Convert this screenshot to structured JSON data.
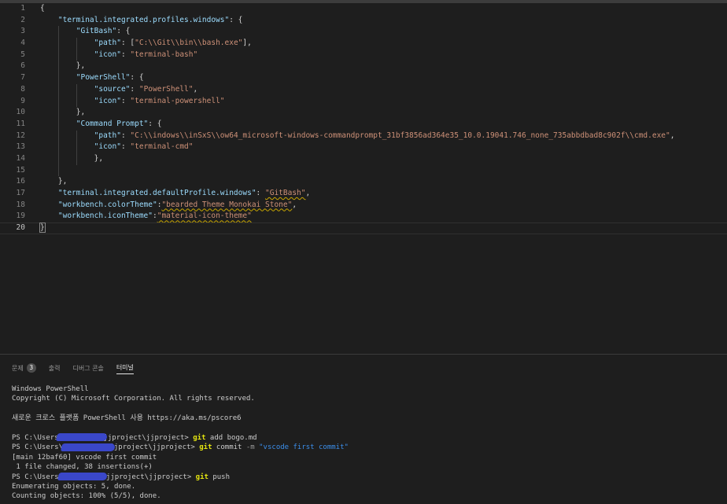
{
  "editor": {
    "lines": [
      {
        "n": "1",
        "indent": 0,
        "tokens": [
          {
            "t": "{",
            "c": "p"
          }
        ]
      },
      {
        "n": "2",
        "indent": 1,
        "tokens": [
          {
            "t": "\"terminal.integrated.profiles.windows\"",
            "c": "k"
          },
          {
            "t": ": {",
            "c": "p"
          }
        ]
      },
      {
        "n": "3",
        "indent": 2,
        "tokens": [
          {
            "t": "\"GitBash\"",
            "c": "k"
          },
          {
            "t": ": {",
            "c": "p"
          }
        ]
      },
      {
        "n": "4",
        "indent": 3,
        "tokens": [
          {
            "t": "\"path\"",
            "c": "k"
          },
          {
            "t": ": [",
            "c": "p"
          },
          {
            "t": "\"C:\\\\Git\\\\bin\\\\bash.exe\"",
            "c": "s"
          },
          {
            "t": "],",
            "c": "p"
          }
        ]
      },
      {
        "n": "5",
        "indent": 3,
        "tokens": [
          {
            "t": "\"icon\"",
            "c": "k"
          },
          {
            "t": ": ",
            "c": "p"
          },
          {
            "t": "\"terminal-bash\"",
            "c": "s"
          }
        ]
      },
      {
        "n": "6",
        "indent": 2,
        "tokens": [
          {
            "t": "},",
            "c": "p"
          }
        ]
      },
      {
        "n": "7",
        "indent": 2,
        "tokens": [
          {
            "t": "\"PowerShell\"",
            "c": "k"
          },
          {
            "t": ": {",
            "c": "p"
          }
        ]
      },
      {
        "n": "8",
        "indent": 3,
        "tokens": [
          {
            "t": "\"source\"",
            "c": "k"
          },
          {
            "t": ": ",
            "c": "p"
          },
          {
            "t": "\"PowerShell\"",
            "c": "s"
          },
          {
            "t": ",",
            "c": "p"
          }
        ]
      },
      {
        "n": "9",
        "indent": 3,
        "tokens": [
          {
            "t": "\"icon\"",
            "c": "k"
          },
          {
            "t": ": ",
            "c": "p"
          },
          {
            "t": "\"terminal-powershell\"",
            "c": "s"
          }
        ]
      },
      {
        "n": "10",
        "indent": 2,
        "tokens": [
          {
            "t": "},",
            "c": "p"
          }
        ]
      },
      {
        "n": "11",
        "indent": 2,
        "tokens": [
          {
            "t": "\"Command Prompt\"",
            "c": "k"
          },
          {
            "t": ": {",
            "c": "p"
          }
        ]
      },
      {
        "n": "12",
        "indent": 3,
        "tokens": [
          {
            "t": "\"path\"",
            "c": "k"
          },
          {
            "t": ": ",
            "c": "p"
          },
          {
            "t": "\"C:\\\\indows\\\\inSxS\\\\ow64_microsoft-windows-commandprompt_31bf3856ad364e35_10.0.19041.746_none_735abbdbad8c902f\\\\cmd.exe\"",
            "c": "s"
          },
          {
            "t": ",",
            "c": "p"
          }
        ]
      },
      {
        "n": "13",
        "indent": 3,
        "tokens": [
          {
            "t": "\"icon\"",
            "c": "k"
          },
          {
            "t": ": ",
            "c": "p"
          },
          {
            "t": "\"terminal-cmd\"",
            "c": "s"
          }
        ]
      },
      {
        "n": "14",
        "indent": 3,
        "tokens": [
          {
            "t": "},",
            "c": "p"
          }
        ]
      },
      {
        "n": "15",
        "indent": 2,
        "tokens": []
      },
      {
        "n": "16",
        "indent": 1,
        "tokens": [
          {
            "t": "},",
            "c": "p"
          }
        ]
      },
      {
        "n": "17",
        "indent": 1,
        "tokens": [
          {
            "t": "\"terminal.integrated.defaultProfile.windows\"",
            "c": "k"
          },
          {
            "t": ": ",
            "c": "p"
          },
          {
            "t": "\"GitBash\"",
            "c": "s sq"
          },
          {
            "t": ",",
            "c": "p"
          }
        ]
      },
      {
        "n": "18",
        "indent": 1,
        "tokens": [
          {
            "t": "\"workbench.colorTheme\"",
            "c": "k"
          },
          {
            "t": ":",
            "c": "p"
          },
          {
            "t": "\"bearded Theme Monokai Stone\"",
            "c": "s sq"
          },
          {
            "t": ",",
            "c": "p"
          }
        ]
      },
      {
        "n": "19",
        "indent": 1,
        "tokens": [
          {
            "t": "\"workbench.iconTheme\"",
            "c": "k"
          },
          {
            "t": ":",
            "c": "p"
          },
          {
            "t": "\"material-icon-theme\"",
            "c": "s sq"
          }
        ]
      },
      {
        "n": "20",
        "indent": 0,
        "current": true,
        "tokens": [
          {
            "t": "}",
            "c": "p bracket-hl"
          }
        ]
      }
    ]
  },
  "panel": {
    "tabs": [
      {
        "label": "문제",
        "badge": "3",
        "active": false
      },
      {
        "label": "출력",
        "active": false
      },
      {
        "label": "디버그 콘솔",
        "active": false
      },
      {
        "label": "터미널",
        "active": true
      }
    ]
  },
  "terminal": {
    "lines": [
      {
        "segments": [
          {
            "t": "Windows PowerShell"
          }
        ]
      },
      {
        "segments": [
          {
            "t": "Copyright (C) Microsoft Corporation. All rights reserved."
          }
        ]
      },
      {
        "blank": true
      },
      {
        "segments": [
          {
            "t": "새로운 크로스 플랫폼 PowerShell 사용 https://aka.ms/pscore6"
          }
        ]
      },
      {
        "blank": true
      },
      {
        "segments": [
          {
            "t": "PS C:\\Users\\"
          },
          {
            "redact": "r1"
          },
          {
            "t": "\\jjproject\\jjproject> "
          },
          {
            "t": "git",
            "c": "cmd"
          },
          {
            "t": " add bogo.md"
          }
        ]
      },
      {
        "segments": [
          {
            "t": "PS C:\\Users\\"
          },
          {
            "redact": "r2"
          },
          {
            "t": "\\jjproject\\jjproject> "
          },
          {
            "t": "git",
            "c": "cmd"
          },
          {
            "t": " commit "
          },
          {
            "t": "-m",
            "c": "flag"
          },
          {
            "t": " "
          },
          {
            "t": "\"vscode first commit\"",
            "c": "str"
          }
        ]
      },
      {
        "segments": [
          {
            "t": "[main 12baf60] vscode first commit"
          }
        ]
      },
      {
        "segments": [
          {
            "t": " 1 file changed, 38 insertions(+)"
          }
        ]
      },
      {
        "segments": [
          {
            "t": "PS C:\\Users\\"
          },
          {
            "redact": "r3"
          },
          {
            "t": "9\\jjproject\\jjproject> "
          },
          {
            "t": "git",
            "c": "cmd"
          },
          {
            "t": " push"
          }
        ]
      },
      {
        "segments": [
          {
            "t": "Enumerating objects: 5, done."
          }
        ]
      },
      {
        "segments": [
          {
            "t": "Counting objects: 100% (5/5), done."
          }
        ]
      }
    ]
  }
}
